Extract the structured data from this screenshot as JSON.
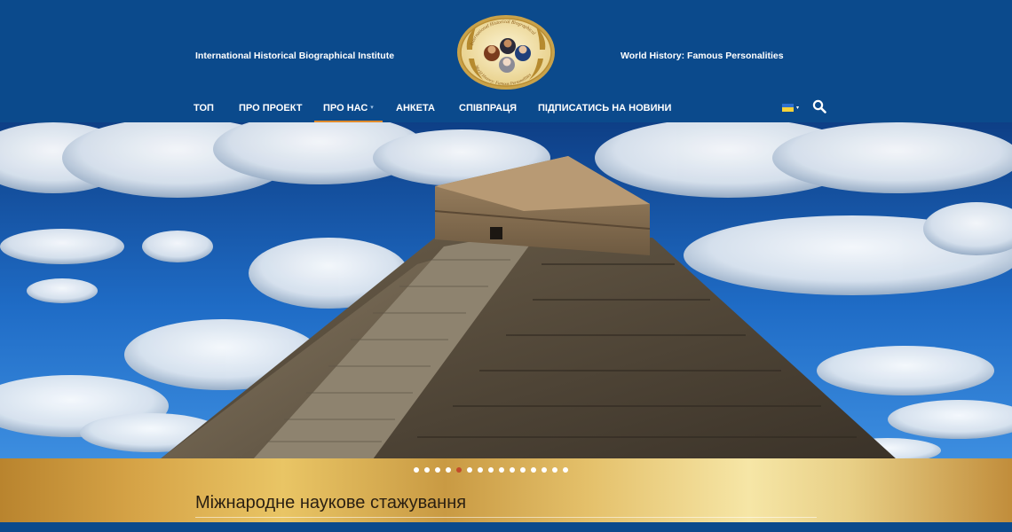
{
  "header": {
    "tagline_left": "International Historical Biographical Institute",
    "tagline_right": "World History: Famous Personalities",
    "logo": {
      "ring_text_top": "International Historical Biographical",
      "ring_text_bottom": "World History: Famous Personalities"
    }
  },
  "nav": {
    "items": [
      {
        "label": "ТОП"
      },
      {
        "label": "ПРО ПРОЕКТ"
      },
      {
        "label": "ПРО НАС",
        "active": true,
        "has_dropdown": true
      },
      {
        "label": "АНКЕТА"
      },
      {
        "label": "СПІВПРАЦЯ"
      },
      {
        "label": "ПІДПИСАТИСЬ НА НОВИНИ"
      }
    ],
    "language_icon": "ukraine-flag-icon",
    "search_icon": "search-icon"
  },
  "hero": {
    "image": "Chichen Itza pyramid under blue sky with clouds"
  },
  "slider": {
    "total_slides": 15,
    "active_slide": 5,
    "caption": "Міжнародне наукове стажування"
  },
  "colors": {
    "header_bg": "#0b4a8c",
    "active_underline": "#e08b2c",
    "banner_gold": "#d7a548",
    "active_dot": "#c24b2a"
  }
}
